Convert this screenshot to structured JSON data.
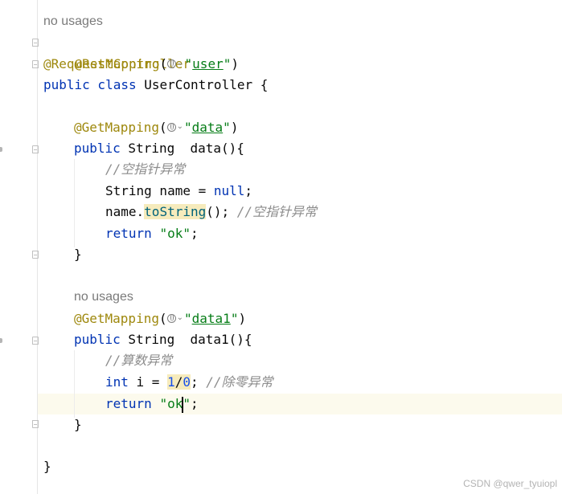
{
  "editor": {
    "hints": {
      "class_usages": "no usages",
      "method_usages": "no usages"
    },
    "class": {
      "annotation_rest": "@RestController",
      "annotation_mapping": "@RequestMapping",
      "mapping_paren_open": "(",
      "mapping_value": "user",
      "mapping_close": ")",
      "declaration": "public class UserController {",
      "closing_brace": "}"
    },
    "method_data": {
      "annotation": "@GetMapping",
      "paren_open": "(",
      "value": "data",
      "paren_close": ")",
      "kw_public": "public",
      "signature_rest": " String  data(){",
      "comment_1": "//空指针异常",
      "decl_type": "String name = ",
      "decl_null": "null",
      "decl_end": ";",
      "call_obj": "name.",
      "call_method": "toString",
      "call_end": "(); ",
      "comment_2": "//空指针异常",
      "return_kw": "return",
      "return_val": "\"ok\"",
      "return_end": ";",
      "closing_brace": "}"
    },
    "method_data1": {
      "annotation": "@GetMapping",
      "paren_open": "(",
      "value": "data1",
      "paren_close": ")",
      "kw_public": "public",
      "signature_rest": " String  data1(){",
      "comment_1": "//算数异常",
      "int_kw": "int",
      "int_rest": " i = ",
      "num_1": "1",
      "slash": "/",
      "num_0": "0",
      "int_end": "; ",
      "comment_2": "//除零异常",
      "return_kw": "return",
      "return_val_before_caret": "\"ok",
      "return_val_after_caret": "\"",
      "return_end": ";",
      "closing_brace": "}"
    }
  },
  "watermark": "CSDN @qwer_tyuiopl",
  "colors": {
    "annotation": "#9e880d",
    "keyword": "#0033b3",
    "string": "#067d17",
    "comment": "#8c8c8c",
    "number": "#1750eb",
    "method_call": "#00627a",
    "current_line": "#fcfaed"
  }
}
